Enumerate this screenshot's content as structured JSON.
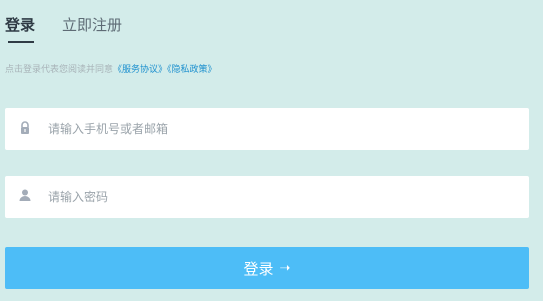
{
  "tabs": {
    "login_label": "登录",
    "register_label": "立即注册"
  },
  "agreement": {
    "prefix": "点击登录代表您阅读并同意",
    "terms_link": "《服务协议》",
    "privacy_link": "《隐私政策》"
  },
  "account_field": {
    "icon": "lock-icon",
    "placeholder": "请输入手机号或者邮箱",
    "value": ""
  },
  "password_field": {
    "icon": "user-icon",
    "placeholder": "请输入密码",
    "value": ""
  },
  "submit": {
    "label": "登录",
    "icon": "arrow-right-icon",
    "arrow_glyph": "➝"
  },
  "colors": {
    "background": "#d3ecea",
    "accent": "#4dbdf7",
    "link": "#1b8fce"
  }
}
